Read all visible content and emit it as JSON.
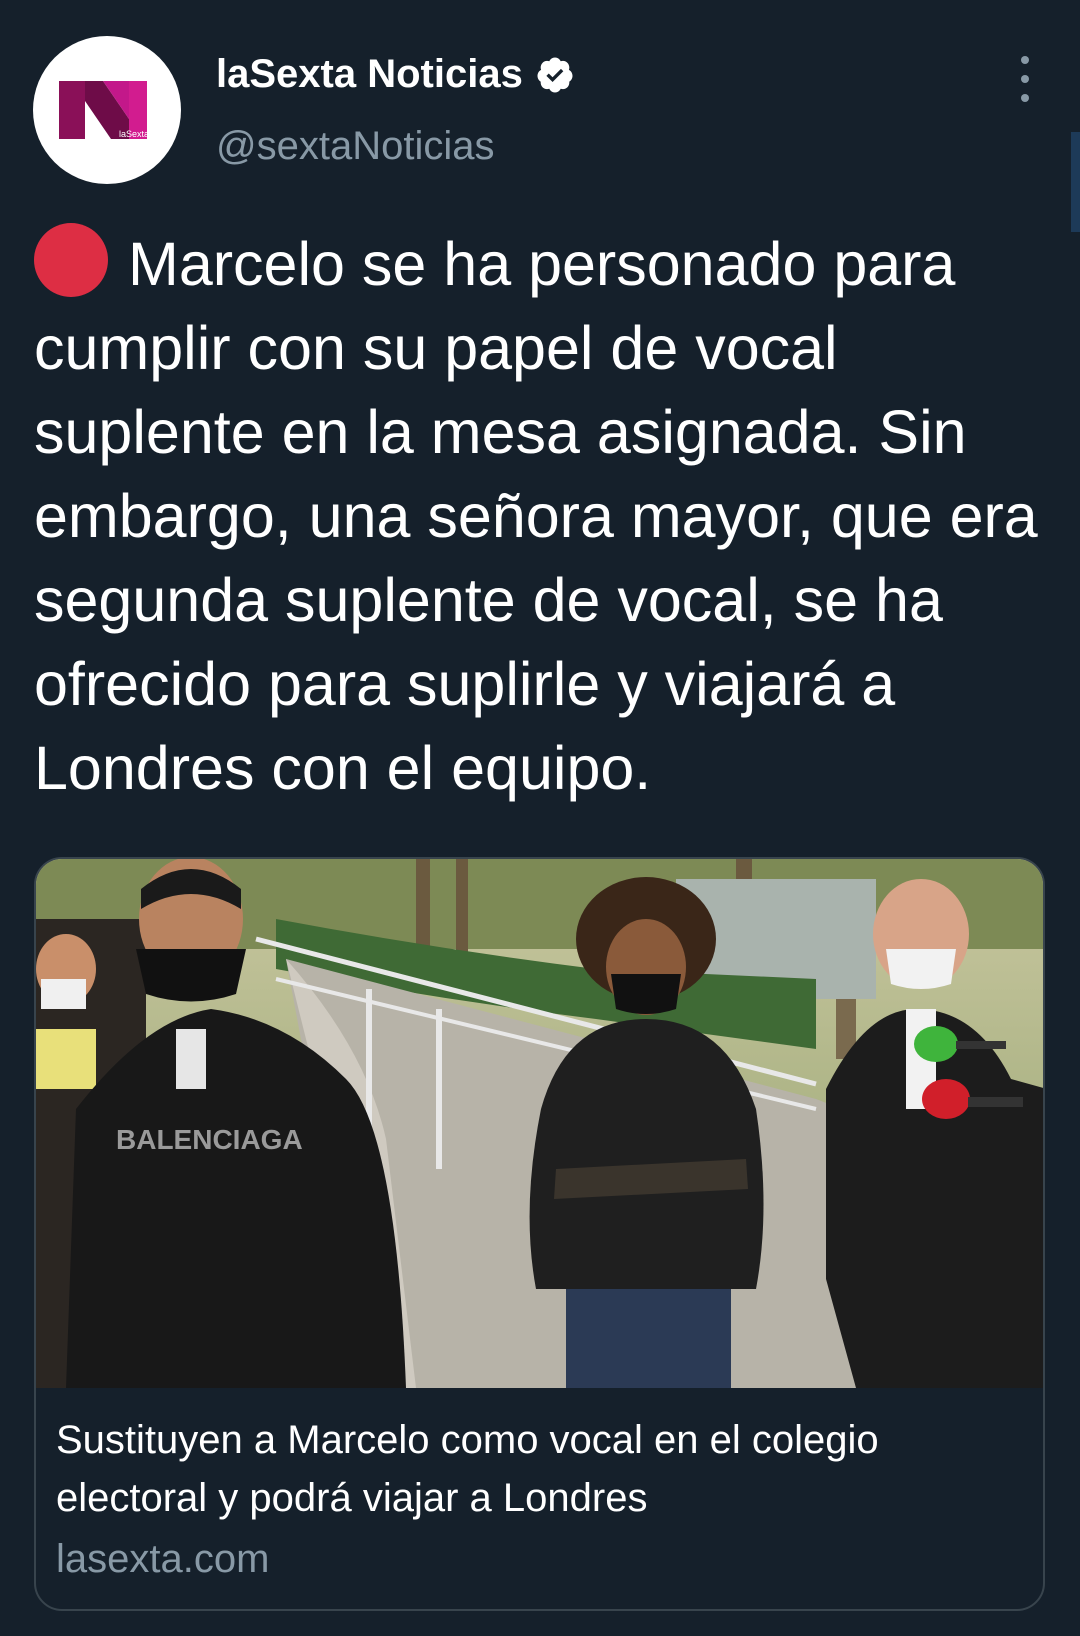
{
  "author": {
    "display_name": "laSexta Noticias",
    "handle": "@sextaNoticias",
    "verified": true,
    "avatar_logo_text": "laSexta"
  },
  "tweet": {
    "text": "Marcelo se ha personado para cumplir con su papel de vocal suplente en la mesa asignada. Sin embargo, una señora mayor, que era segunda suplente de vocal, se ha ofrecido para suplirle y viajará a Londres con el equipo.",
    "leading_emoji": "red-circle"
  },
  "card": {
    "title": "Sustituyen a Marcelo como vocal en el colegio electoral y podrá viajar a Londres",
    "domain": "lasexta.com",
    "image_sweatshirt_text": "BALENCIAGA"
  },
  "colors": {
    "background": "#15202b",
    "text_primary": "#ffffff",
    "text_secondary": "#8899a6",
    "border": "#38444d",
    "red_circle": "#dd2e44",
    "logo_magenta": "#b5157c"
  },
  "icons": {
    "verified": "verified-badge-icon",
    "more": "more-options-icon"
  }
}
